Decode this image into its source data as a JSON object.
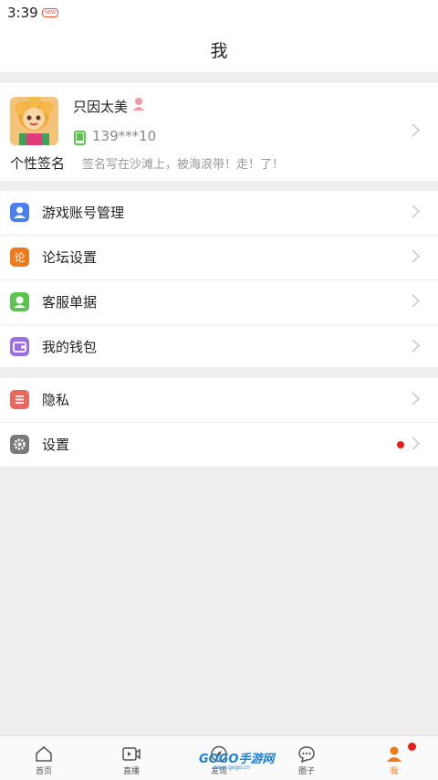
{
  "status_bar": {
    "time": "3:39",
    "notification_text": "NEW"
  },
  "header": {
    "title": "我"
  },
  "profile": {
    "username": "只因太美",
    "phone": "139***10",
    "signature_label": "个性签名",
    "signature": "签名写在沙滩上，被海浪带！走！了！"
  },
  "menu_group_1": [
    {
      "label": "游戏账号管理",
      "icon": "user-icon",
      "color": "#4a7ff0"
    },
    {
      "label": "论坛设置",
      "icon": "forum-icon",
      "color": "#f07a1a"
    },
    {
      "label": "客服单据",
      "icon": "service-icon",
      "color": "#5cc44e"
    },
    {
      "label": "我的钱包",
      "icon": "wallet-icon",
      "color": "#9b6ee6"
    }
  ],
  "menu_group_2": [
    {
      "label": "隐私",
      "icon": "privacy-icon",
      "color": "#e8685e"
    },
    {
      "label": "设置",
      "icon": "gear-icon",
      "color": "#7a7a7a"
    }
  ],
  "tab_bar": [
    {
      "label": "首页",
      "icon": "home-icon"
    },
    {
      "label": "直播",
      "icon": "video-icon"
    },
    {
      "label": "发现",
      "icon": "discover-icon"
    },
    {
      "label": "圈子",
      "icon": "chat-icon"
    },
    {
      "label": "我",
      "icon": "me-icon",
      "active": true
    }
  ],
  "watermark": {
    "brand": "GOGO手游网",
    "url": "www.gogo.cn"
  }
}
